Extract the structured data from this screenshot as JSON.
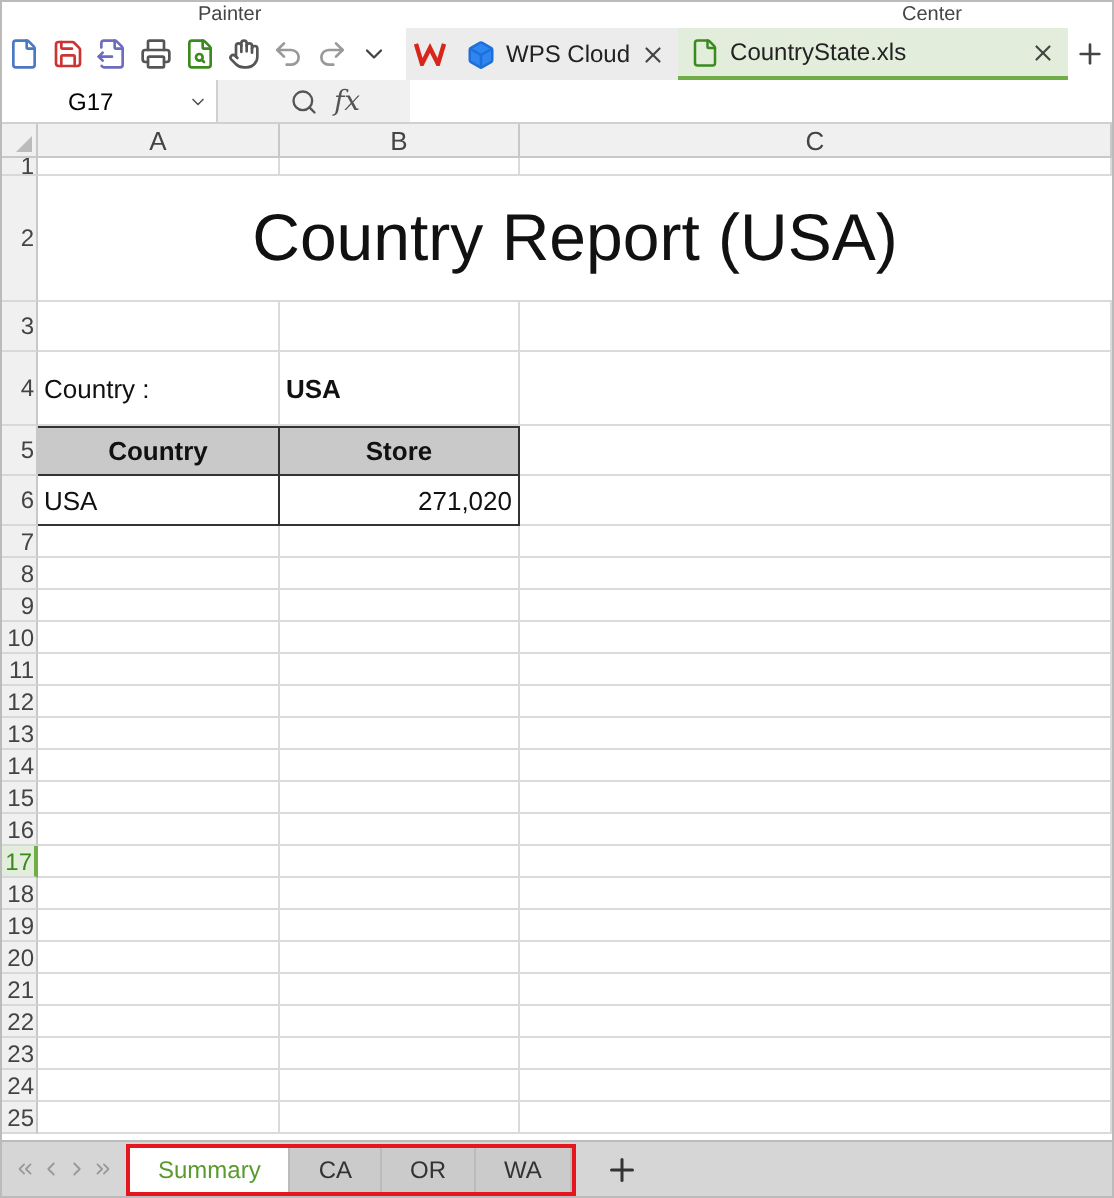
{
  "ribbon_labels": [
    "Painter",
    "Center"
  ],
  "doc_tabs": [
    {
      "label": "WPS Cloud",
      "kind": "cloud",
      "selected": false
    },
    {
      "label": "CountryState.xls",
      "kind": "sheet",
      "selected": true
    }
  ],
  "formula_bar": {
    "name_box": "G17",
    "function_label": "fx"
  },
  "columns": [
    "A",
    "B",
    "C"
  ],
  "rows": [
    {
      "number": "1",
      "selected": false
    },
    {
      "number": "2",
      "selected": false,
      "kind": "title",
      "cells": [
        "Country Report (USA)"
      ]
    },
    {
      "number": "3",
      "selected": false
    },
    {
      "number": "4",
      "selected": false,
      "kind": "label",
      "cells": [
        "Country :",
        "USA"
      ]
    },
    {
      "number": "5",
      "selected": false,
      "kind": "header",
      "cells": [
        "Country",
        "Store"
      ]
    },
    {
      "number": "6",
      "selected": false,
      "kind": "data",
      "cells": [
        "USA",
        "271,020"
      ]
    },
    {
      "number": "7",
      "selected": false
    },
    {
      "number": "8",
      "selected": false
    },
    {
      "number": "9",
      "selected": false
    },
    {
      "number": "10",
      "selected": false
    },
    {
      "number": "11",
      "selected": false
    },
    {
      "number": "12",
      "selected": false
    },
    {
      "number": "13",
      "selected": false
    },
    {
      "number": "14",
      "selected": false
    },
    {
      "number": "15",
      "selected": false
    },
    {
      "number": "16",
      "selected": false
    },
    {
      "number": "17",
      "selected": true
    },
    {
      "number": "18",
      "selected": false
    },
    {
      "number": "19",
      "selected": false
    },
    {
      "number": "20",
      "selected": false
    },
    {
      "number": "21",
      "selected": false
    },
    {
      "number": "22",
      "selected": false
    },
    {
      "number": "23",
      "selected": false
    },
    {
      "number": "24",
      "selected": false
    },
    {
      "number": "25",
      "selected": false
    }
  ],
  "sheet_tabs": [
    {
      "label": "Summary",
      "selected": true
    },
    {
      "label": "CA",
      "selected": false
    },
    {
      "label": "OR",
      "selected": false
    },
    {
      "label": "WA",
      "selected": false
    }
  ]
}
